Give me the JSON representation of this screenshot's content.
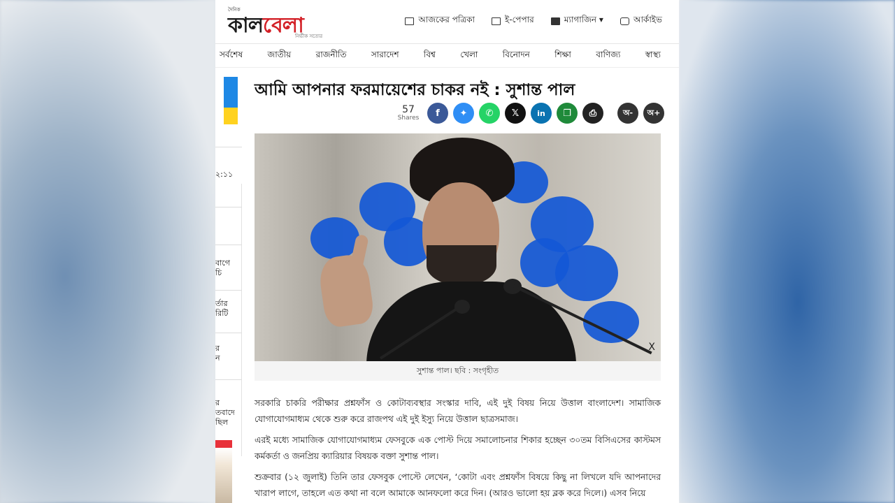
{
  "brand": {
    "logo_small": "দৈনিক",
    "logo_main_a": "কাল",
    "logo_main_b": "বেলা",
    "logo_tag": "নির্ভীক সত্যের"
  },
  "toplinks": [
    {
      "label": "আজকের পত্রিকা",
      "icon": "newspaper-icon"
    },
    {
      "label": "ই-পেপার",
      "icon": "epaper-icon"
    },
    {
      "label": "ম্যাগাজিন ▾",
      "icon": "magazine-icon"
    },
    {
      "label": "আর্কাইভ",
      "icon": "archive-icon"
    }
  ],
  "nav": [
    "সর্বশেষ",
    "জাতীয়",
    "রাজনীতি",
    "সারাদেশ",
    "বিশ্ব",
    "খেলা",
    "বিনোদন",
    "শিক্ষা",
    "বাণিজ্য",
    "স্বাস্থ্য"
  ],
  "rail": {
    "time": "২:১১",
    "items": [
      "বাগে\nচি",
      "র্তার\nরিটি",
      "র\nন",
      "র\nতবাদে\nছিল"
    ]
  },
  "article": {
    "headline": "আমি আপনার ফরমায়েশের চাকর নই : সুশান্ত পাল",
    "share_count": "57",
    "share_label": "Shares",
    "share_buttons": [
      {
        "name": "facebook",
        "glyph": "f",
        "color": "#3b5998"
      },
      {
        "name": "messenger",
        "glyph": "✦",
        "color": "#2f8ef5"
      },
      {
        "name": "whatsapp",
        "glyph": "✆",
        "color": "#25d366"
      },
      {
        "name": "x",
        "glyph": "𝕏",
        "color": "#111111"
      },
      {
        "name": "linkedin",
        "glyph": "in",
        "color": "#0a73b1"
      },
      {
        "name": "copy",
        "glyph": "❐",
        "color": "#1f8a3a"
      },
      {
        "name": "print",
        "glyph": "⎙",
        "color": "#222222"
      }
    ],
    "font_minus": "অ-",
    "font_plus": "অ+",
    "close": "X",
    "caption": "সুশান্ত পাল। ছবি : সংগৃহীত",
    "paragraphs": [
      "সরকারি চাকরি পরীক্ষার প্রশ্নফাঁস ও কোটাব্যবস্থার সংস্কার দাবি, এই দুই বিষয় নিয়ে উত্তাল বাংলাদেশ। সামাজিক যোগাযোগমাধ্যম থেকে শুরু করে রাজপথ এই দুই ইস্যু নিয়ে উত্তাল ছাত্রসমাজ।",
      "এরই মধ্যে সামাজিক যোগাযোগমাধ্যম ফেসবুকে এক পোস্ট দিয়ে সমালোচনার শিকার হচ্ছেন ৩০তম বিসিএসের কাস্টমস কর্মকর্তা ও জনপ্রিয় ক্যারিয়ার বিষয়ক বক্তা সুশান্ত পাল।",
      "শুক্রবার (১২ জুলাই) তিনি তার ফেসবুক পোস্টে লেখেন, ‘কোটা এবং প্রশ্নফাঁস বিষয়ে কিছু না লিখলে যদি আপনাদের খারাপ লাগে, তাহলে এত কথা না বলে আমাকে আনফলো করে দিন। (আরও ভালো হয় ব্লক করে দিলে।) এসব নিয়ে"
    ]
  }
}
